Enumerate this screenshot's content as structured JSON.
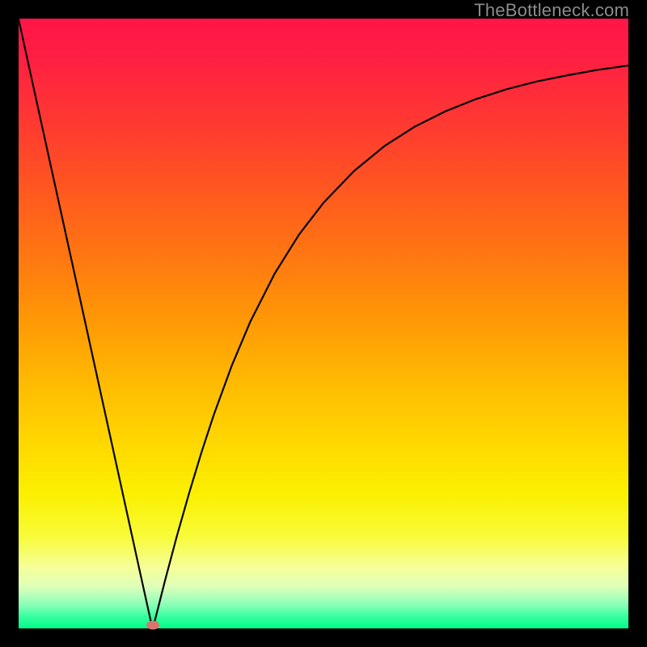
{
  "watermark": "TheBottleneck.com",
  "colors": {
    "frame": "#000000",
    "curve": "#040404",
    "marker": "#d8766e",
    "gradient_top": "#ff1648",
    "gradient_bottom": "#00ff88"
  },
  "chart_data": {
    "type": "line",
    "title": "",
    "xlabel": "",
    "ylabel": "",
    "xlim": [
      0,
      100
    ],
    "ylim": [
      0,
      100
    ],
    "grid": false,
    "legend": false,
    "marker": {
      "x": 22,
      "y": 0.5
    },
    "series": [
      {
        "name": "left-linear-descent",
        "x": [
          0,
          5,
          10,
          15,
          20,
          21.9
        ],
        "y": [
          99.9,
          77.1,
          54.4,
          31.6,
          8.8,
          0.2
        ]
      },
      {
        "name": "right-saturating-ascent",
        "x": [
          22.1,
          24,
          26,
          28,
          30,
          32,
          35,
          38,
          42,
          46,
          50,
          55,
          60,
          65,
          70,
          75,
          80,
          85,
          90,
          95,
          100
        ],
        "y": [
          0.3,
          7.8,
          15.3,
          22.3,
          28.9,
          35.0,
          43.2,
          50.3,
          58.2,
          64.6,
          69.8,
          75.0,
          79.1,
          82.3,
          84.8,
          86.8,
          88.4,
          89.7,
          90.7,
          91.6,
          92.3
        ]
      }
    ]
  }
}
